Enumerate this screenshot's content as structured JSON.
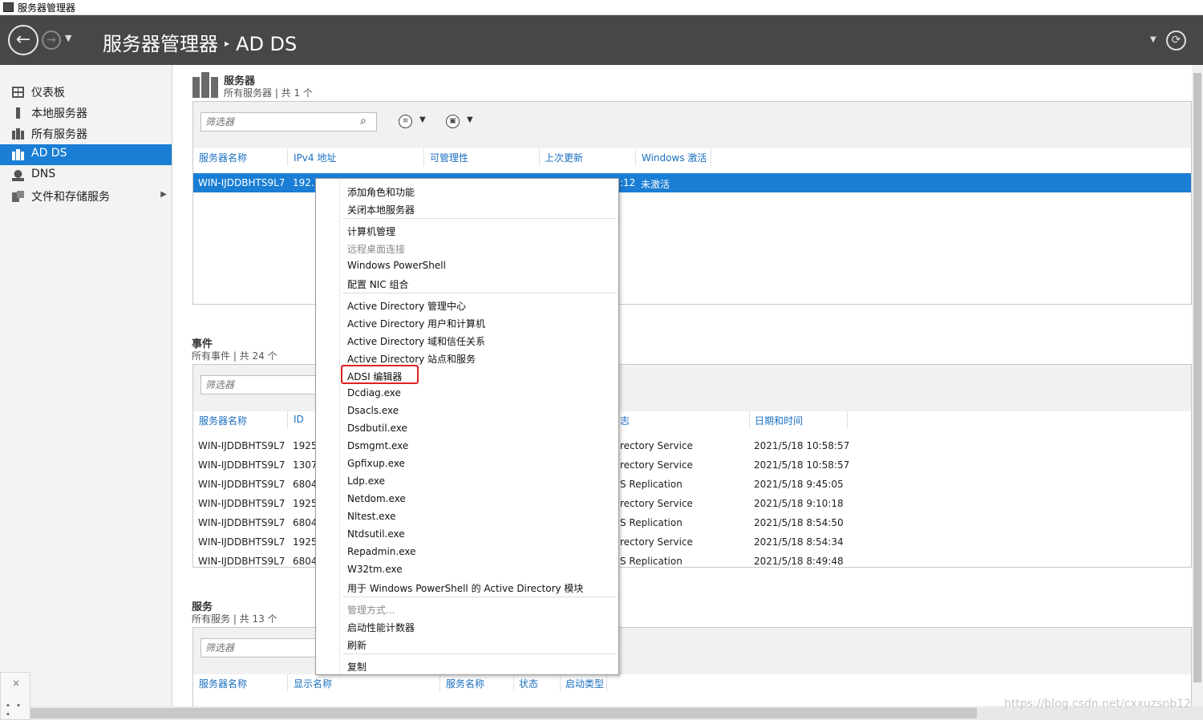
{
  "window": {
    "title": "服务器管理器"
  },
  "header": {
    "app_name": "服务器管理器",
    "separator": "▸",
    "current": "AD DS"
  },
  "sidebar": {
    "items": [
      {
        "label": "仪表板",
        "icon": "dashboard-icon"
      },
      {
        "label": "本地服务器",
        "icon": "local-server-icon"
      },
      {
        "label": "所有服务器",
        "icon": "all-servers-icon"
      },
      {
        "label": "AD DS",
        "icon": "ad-ds-icon",
        "active": true
      },
      {
        "label": "DNS",
        "icon": "dns-icon"
      },
      {
        "label": "文件和存储服务",
        "icon": "file-storage-icon",
        "has_submenu": true
      }
    ]
  },
  "servers": {
    "title": "服务器",
    "subtitle": "所有服务器 | 共 1 个",
    "filter_placeholder": "筛选器",
    "columns": [
      "服务器名称",
      "IPv4 地址",
      "可管理性",
      "上次更新",
      "Windows 激活"
    ],
    "rows": [
      {
        "name": "WIN-IJDDBHTS9L7",
        "ip": "192.1",
        "update": ":12",
        "activation": "未激活"
      }
    ]
  },
  "events": {
    "title": "事件",
    "subtitle": "所有事件 | 共 24 个",
    "filter_placeholder": "筛选器",
    "columns": [
      "服务器名称",
      "ID",
      "志",
      "日期和时间"
    ],
    "rows": [
      {
        "server": "WIN-IJDDBHTS9L7",
        "id": "1925",
        "log": "rectory Service",
        "datetime": "2021/5/18 10:58:57"
      },
      {
        "server": "WIN-IJDDBHTS9L7",
        "id": "1307",
        "log": "rectory Service",
        "datetime": "2021/5/18 10:58:57"
      },
      {
        "server": "WIN-IJDDBHTS9L7",
        "id": "6804",
        "log": "S Replication",
        "datetime": "2021/5/18 9:45:05"
      },
      {
        "server": "WIN-IJDDBHTS9L7",
        "id": "1925",
        "log": "rectory Service",
        "datetime": "2021/5/18 9:10:18"
      },
      {
        "server": "WIN-IJDDBHTS9L7",
        "id": "6804",
        "log": "S Replication",
        "datetime": "2021/5/18 8:54:50"
      },
      {
        "server": "WIN-IJDDBHTS9L7",
        "id": "1925",
        "log": "rectory Service",
        "datetime": "2021/5/18 8:54:34"
      },
      {
        "server": "WIN-IJDDBHTS9L7",
        "id": "6804",
        "log": "S Replication",
        "datetime": "2021/5/18 8:49:48"
      }
    ]
  },
  "services": {
    "title": "服务",
    "subtitle": "所有服务 | 共 13 个",
    "filter_placeholder": "筛选器",
    "columns": [
      "服务器名称",
      "显示名称",
      "服务名称",
      "状态",
      "启动类型"
    ]
  },
  "context_menu": {
    "groups": [
      [
        {
          "label": "添加角色和功能"
        },
        {
          "label": "关闭本地服务器"
        }
      ],
      [
        {
          "label": "计算机管理"
        },
        {
          "label": "远程桌面连接",
          "disabled": true
        },
        {
          "label": "Windows PowerShell"
        },
        {
          "label": "配置 NIC 组合"
        }
      ],
      [
        {
          "label": "Active Directory 管理中心"
        },
        {
          "label": "Active Directory 用户和计算机"
        },
        {
          "label": "Active Directory 域和信任关系"
        },
        {
          "label": "Active Directory 站点和服务"
        },
        {
          "label": "ADSI 编辑器",
          "highlighted": true
        },
        {
          "label": "Dcdiag.exe"
        },
        {
          "label": "Dsacls.exe"
        },
        {
          "label": "Dsdbutil.exe"
        },
        {
          "label": "Dsmgmt.exe"
        },
        {
          "label": "Gpfixup.exe"
        },
        {
          "label": "Ldp.exe"
        },
        {
          "label": "Netdom.exe"
        },
        {
          "label": "Nltest.exe"
        },
        {
          "label": "Ntdsutil.exe"
        },
        {
          "label": "Repadmin.exe"
        },
        {
          "label": "W32tm.exe"
        },
        {
          "label": "用于 Windows PowerShell 的 Active Directory 模块"
        }
      ],
      [
        {
          "label": "管理方式...",
          "disabled": true
        },
        {
          "label": "启动性能计数器"
        },
        {
          "label": "刷新"
        }
      ],
      [
        {
          "label": "复制"
        }
      ]
    ]
  },
  "highlight_color": "#e02020",
  "accent_color": "#1a7ed4",
  "watermark": "https://blog.csdn.net/cxxuzsnb12"
}
